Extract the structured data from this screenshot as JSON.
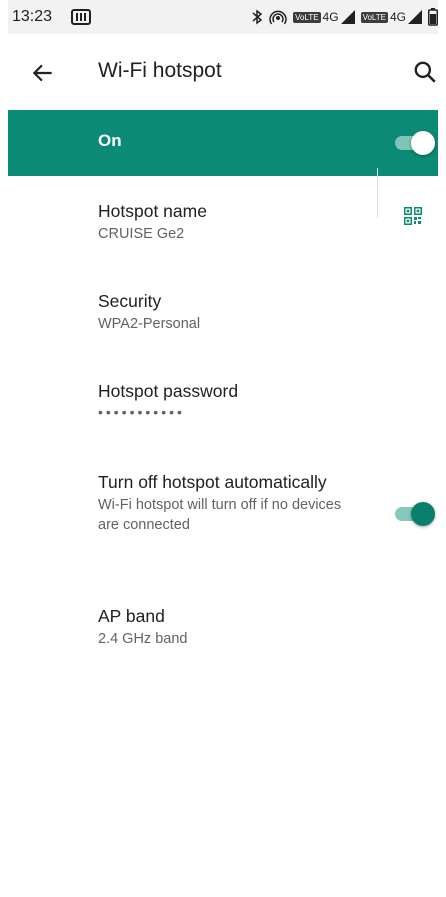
{
  "status_bar": {
    "time": "13:23",
    "volte1": "VoLTE",
    "net1": "4G",
    "volte2": "VoLTE",
    "net2": "4G",
    "icons": [
      "sim-card-icon",
      "bluetooth-icon",
      "hotspot-icon",
      "signal-icon",
      "signal-icon",
      "battery-icon"
    ]
  },
  "app_bar": {
    "title": "Wi-Fi hotspot",
    "back_icon": "arrow-back-icon",
    "search_icon": "search-icon"
  },
  "master_switch": {
    "label": "On",
    "checked": true
  },
  "prefs": {
    "hotspot_name": {
      "title": "Hotspot name",
      "value": "CRUISE Ge2",
      "action_icon": "qr-code-icon"
    },
    "security": {
      "title": "Security",
      "value": "WPA2-Personal"
    },
    "password": {
      "title": "Hotspot password",
      "masked": "•••••••••••"
    },
    "auto_off": {
      "title": "Turn off hotspot automatically",
      "summary": "Wi-Fi hotspot will turn off if no devices are connected",
      "checked": true
    },
    "ap_band": {
      "title": "AP band",
      "value": "2.4 GHz band"
    }
  },
  "colors": {
    "accent": "#0b8a76",
    "switch_on_track": "#87c7bd",
    "switch_on_thumb": "#0b7f6d",
    "status_bar_bg": "#f2f2f2"
  }
}
